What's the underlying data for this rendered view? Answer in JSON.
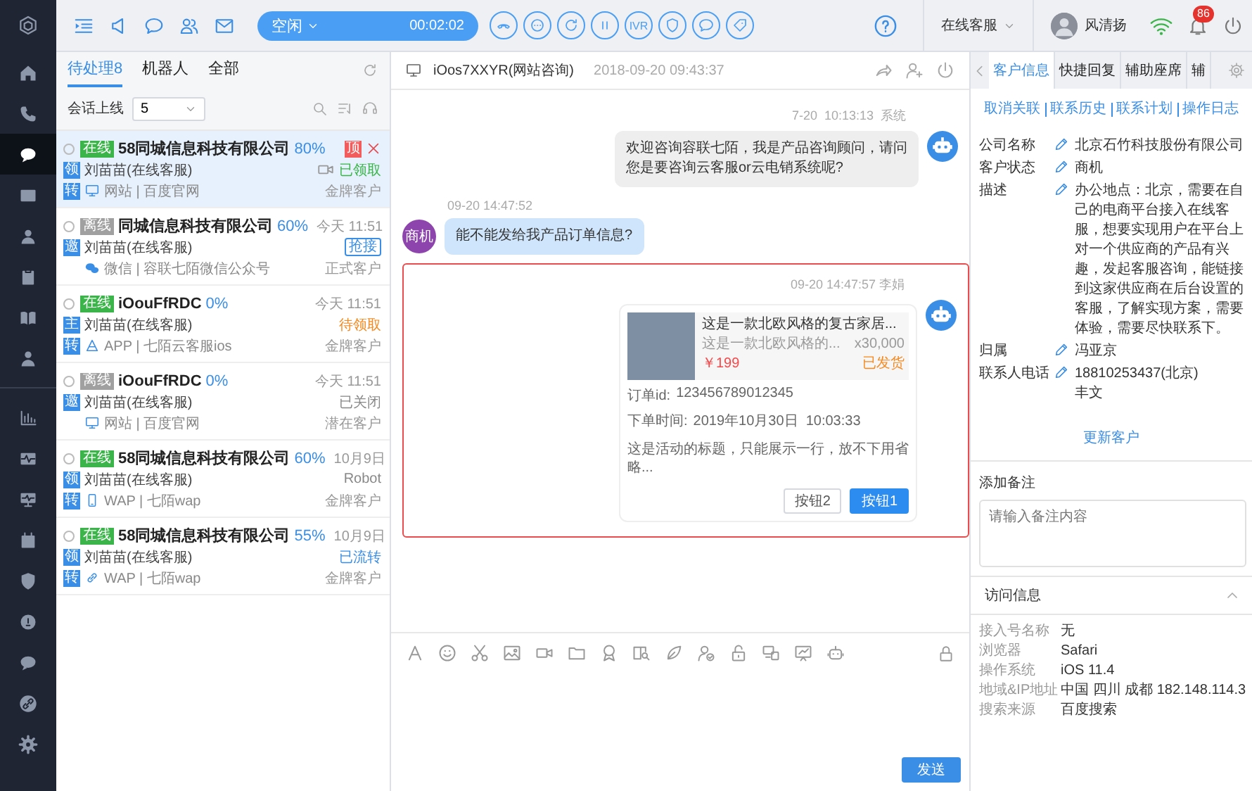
{
  "nav": [
    {
      "selected": false
    },
    {
      "selected": false
    },
    {
      "selected": true
    },
    {
      "selected": false
    },
    {
      "selected": false
    },
    {
      "selected": false
    },
    {
      "selected": false
    },
    {
      "selected": false
    },
    {
      "selected": false
    },
    {
      "selected": false
    },
    {
      "selected": false
    },
    {
      "selected": false
    },
    {
      "selected": false
    },
    {
      "selected": false
    },
    {
      "selected": false
    },
    {
      "selected": false
    },
    {
      "selected": false
    }
  ],
  "topbar": {
    "presence": "空闲",
    "timer": "00:02:02",
    "ivr_label": "IVR",
    "service_mode": "在线客服",
    "user_name": "风清扬",
    "notification_count": "86"
  },
  "session_list": {
    "tabs": [
      {
        "label": "待处理8",
        "selected": true
      },
      {
        "label": "机器人",
        "selected": false
      },
      {
        "label": "全部",
        "selected": false
      }
    ],
    "filter_label": "会话上线",
    "filter_value": "5"
  },
  "sessions": [
    {
      "selected": true,
      "checked": false,
      "presence": {
        "kind": "online",
        "text": "在线"
      },
      "name": "58同城信息科技有限公司",
      "percent": "80%",
      "pin": "顶",
      "role_badge": "领",
      "agent": "刘苗苗(在线客服)",
      "has_video": true,
      "status": {
        "kind": "text",
        "text": "已领取",
        "color": "#3bb54a"
      },
      "transfer_badge": "转",
      "channel": {
        "kind": "web",
        "text": "网站 | 百度官网"
      },
      "tier": "金牌客户"
    },
    {
      "selected": false,
      "checked": false,
      "presence": {
        "kind": "offline",
        "text": "离线"
      },
      "name": "同城信息科技有限公司",
      "percent": "60%",
      "time": "今天 11:51",
      "role_badge": "邀",
      "agent": "刘苗苗(在线客服)",
      "has_video": false,
      "status": {
        "kind": "button",
        "text": "抢接",
        "color": "#3a8ee6"
      },
      "channel": {
        "kind": "wechat",
        "text": "微信 | 容联七陌微信公众号"
      },
      "tier": "正式客户"
    },
    {
      "selected": false,
      "checked": false,
      "presence": {
        "kind": "online",
        "text": "在线"
      },
      "name": "iOouFfRDC",
      "percent": "0%",
      "time": "今天 11:51",
      "role_badge": "主",
      "agent": "刘苗苗(在线客服)",
      "has_video": false,
      "status": {
        "kind": "text",
        "text": "待领取",
        "color": "#f5891f"
      },
      "transfer_badge": "转",
      "channel": {
        "kind": "app",
        "text": "APP | 七陌云客服ios"
      },
      "tier": "金牌客户"
    },
    {
      "selected": false,
      "checked": false,
      "presence": {
        "kind": "offline",
        "text": "离线"
      },
      "name": "iOouFfRDC",
      "percent": "0%",
      "time": "今天 11:51",
      "role_badge": "邀",
      "agent": "刘苗苗(在线客服)",
      "has_video": false,
      "status": {
        "kind": "text",
        "text": "已关闭",
        "color": "#888888"
      },
      "channel": {
        "kind": "web",
        "text": "网站 | 百度官网"
      },
      "tier": "潜在客户"
    },
    {
      "selected": false,
      "checked": false,
      "presence": {
        "kind": "online",
        "text": "在线"
      },
      "name": "58同城信息科技有限公司",
      "percent": "60%",
      "time": "10月9日",
      "role_badge": "领",
      "agent": "刘苗苗(在线客服)",
      "has_video": false,
      "status": {
        "kind": "text",
        "text": "Robot",
        "color": "#888888"
      },
      "transfer_badge": "转",
      "channel": {
        "kind": "wap",
        "text": "WAP | 七陌wap"
      },
      "tier": "金牌客户"
    },
    {
      "selected": false,
      "checked": false,
      "presence": {
        "kind": "online",
        "text": "在线"
      },
      "name": "58同城信息科技有限公司",
      "percent": "55%",
      "time": "10月9日",
      "role_badge": "领",
      "agent": "刘苗苗(在线客服)",
      "has_video": false,
      "status": {
        "kind": "text",
        "text": "已流转",
        "color": "#3a8ee6"
      },
      "transfer_badge": "转",
      "channel": {
        "kind": "link",
        "text": "WAP | 七陌wap"
      },
      "tier": "金牌客户"
    }
  ],
  "chat": {
    "title": "iOos7XXYR(网站咨询)",
    "started": "2018-09-20 09:43:37",
    "messages": [
      {
        "kind": "bot",
        "meta": "7-20  10:13:13  系统",
        "text": "欢迎咨询容联七陌，我是产品咨询顾问，请问您是要咨询云客服or云电销系统呢?"
      },
      {
        "kind": "customer",
        "meta": "09-20 14:47:52",
        "avatar_label": "商机",
        "text": "能不能发给我产品订单信息?"
      },
      {
        "kind": "card",
        "highlighted": true,
        "meta": "09-20 14:47:57 李娟",
        "product": {
          "title": "这是一款北欧风格的复古家居...",
          "subtitle": "这是一款北欧风格的...",
          "quantity": "x30,000",
          "price": "￥199",
          "status": "已发货"
        },
        "order_fields": [
          {
            "label": "订单id:",
            "value": "123456789012345"
          },
          {
            "label": "下单时间:",
            "value": "2019年10月30日  10:03:33"
          }
        ],
        "note": "这是活动的标题，只能展示一行，放不下用省略...",
        "buttons": [
          {
            "label": "按钮2",
            "primary": false
          },
          {
            "label": "按钮1",
            "primary": true
          }
        ]
      }
    ],
    "send_label": "发送"
  },
  "customer_panel": {
    "tabs": [
      {
        "label": "客户信息",
        "selected": true
      },
      {
        "label": "快捷回复",
        "selected": false
      },
      {
        "label": "辅助座席",
        "selected": false
      },
      {
        "label": "辅",
        "selected": false
      }
    ],
    "links": [
      "取消关联",
      "联系历史",
      "联系计划",
      "操作日志"
    ],
    "fields": [
      {
        "label": "公司名称",
        "lines": [
          "北京石竹科技股份有限公司"
        ]
      },
      {
        "label": "客户状态",
        "lines": [
          "商机"
        ]
      },
      {
        "label": "描述",
        "lines": [
          "办公地点：北京，需要在自己的电商平台接入在线客服，想要实现用户在平台上对一个供应商的产品有兴趣，发起客服咨询，能链接到这家供应商在后台设置的客服，了解实现方案，需要体验，需要尽快联系下。"
        ]
      },
      {
        "label": "归属",
        "lines": [
          "冯亚京"
        ]
      },
      {
        "label": "联系人电话",
        "lines": [
          "18810253437(北京)",
          "丰文"
        ]
      }
    ],
    "update_link": "更新客户",
    "note": {
      "title": "添加备注",
      "placeholder": "请输入备注内容"
    }
  },
  "visit_info": {
    "title": "访问信息",
    "expanded": true,
    "rows": [
      {
        "label": "接入号名称",
        "value": "无"
      },
      {
        "label": "浏览器",
        "value": "Safari"
      },
      {
        "label": "操作系统",
        "value": "iOS 11.4"
      },
      {
        "label": "地域&IP地址",
        "value": "中国 四川 成都 182.148.114.3"
      },
      {
        "label": "搜索来源",
        "value": "百度搜索"
      }
    ]
  }
}
